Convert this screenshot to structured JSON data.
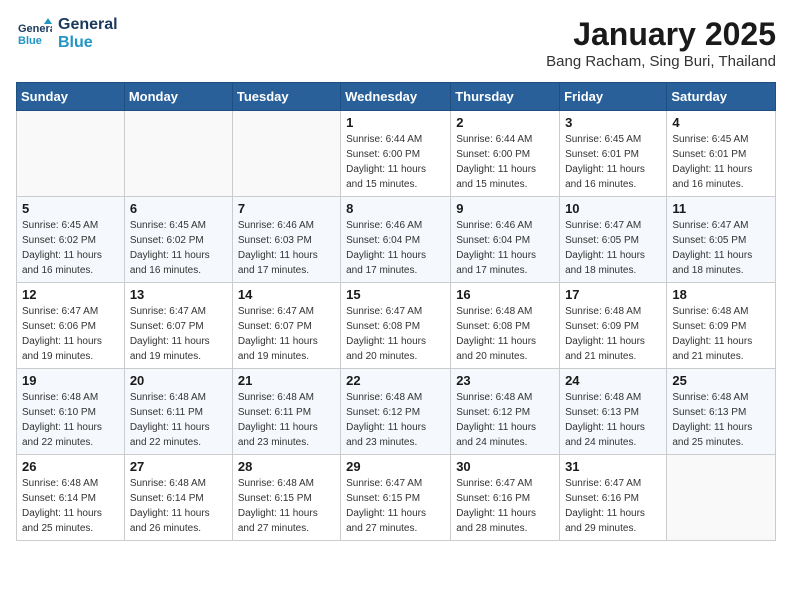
{
  "header": {
    "logo_line1": "General",
    "logo_line2": "Blue",
    "title": "January 2025",
    "subtitle": "Bang Racham, Sing Buri, Thailand"
  },
  "weekdays": [
    "Sunday",
    "Monday",
    "Tuesday",
    "Wednesday",
    "Thursday",
    "Friday",
    "Saturday"
  ],
  "weeks": [
    [
      {
        "day": "",
        "info": ""
      },
      {
        "day": "",
        "info": ""
      },
      {
        "day": "",
        "info": ""
      },
      {
        "day": "1",
        "info": "Sunrise: 6:44 AM\nSunset: 6:00 PM\nDaylight: 11 hours and 15 minutes."
      },
      {
        "day": "2",
        "info": "Sunrise: 6:44 AM\nSunset: 6:00 PM\nDaylight: 11 hours and 15 minutes."
      },
      {
        "day": "3",
        "info": "Sunrise: 6:45 AM\nSunset: 6:01 PM\nDaylight: 11 hours and 16 minutes."
      },
      {
        "day": "4",
        "info": "Sunrise: 6:45 AM\nSunset: 6:01 PM\nDaylight: 11 hours and 16 minutes."
      }
    ],
    [
      {
        "day": "5",
        "info": "Sunrise: 6:45 AM\nSunset: 6:02 PM\nDaylight: 11 hours and 16 minutes."
      },
      {
        "day": "6",
        "info": "Sunrise: 6:45 AM\nSunset: 6:02 PM\nDaylight: 11 hours and 16 minutes."
      },
      {
        "day": "7",
        "info": "Sunrise: 6:46 AM\nSunset: 6:03 PM\nDaylight: 11 hours and 17 minutes."
      },
      {
        "day": "8",
        "info": "Sunrise: 6:46 AM\nSunset: 6:04 PM\nDaylight: 11 hours and 17 minutes."
      },
      {
        "day": "9",
        "info": "Sunrise: 6:46 AM\nSunset: 6:04 PM\nDaylight: 11 hours and 17 minutes."
      },
      {
        "day": "10",
        "info": "Sunrise: 6:47 AM\nSunset: 6:05 PM\nDaylight: 11 hours and 18 minutes."
      },
      {
        "day": "11",
        "info": "Sunrise: 6:47 AM\nSunset: 6:05 PM\nDaylight: 11 hours and 18 minutes."
      }
    ],
    [
      {
        "day": "12",
        "info": "Sunrise: 6:47 AM\nSunset: 6:06 PM\nDaylight: 11 hours and 19 minutes."
      },
      {
        "day": "13",
        "info": "Sunrise: 6:47 AM\nSunset: 6:07 PM\nDaylight: 11 hours and 19 minutes."
      },
      {
        "day": "14",
        "info": "Sunrise: 6:47 AM\nSunset: 6:07 PM\nDaylight: 11 hours and 19 minutes."
      },
      {
        "day": "15",
        "info": "Sunrise: 6:47 AM\nSunset: 6:08 PM\nDaylight: 11 hours and 20 minutes."
      },
      {
        "day": "16",
        "info": "Sunrise: 6:48 AM\nSunset: 6:08 PM\nDaylight: 11 hours and 20 minutes."
      },
      {
        "day": "17",
        "info": "Sunrise: 6:48 AM\nSunset: 6:09 PM\nDaylight: 11 hours and 21 minutes."
      },
      {
        "day": "18",
        "info": "Sunrise: 6:48 AM\nSunset: 6:09 PM\nDaylight: 11 hours and 21 minutes."
      }
    ],
    [
      {
        "day": "19",
        "info": "Sunrise: 6:48 AM\nSunset: 6:10 PM\nDaylight: 11 hours and 22 minutes."
      },
      {
        "day": "20",
        "info": "Sunrise: 6:48 AM\nSunset: 6:11 PM\nDaylight: 11 hours and 22 minutes."
      },
      {
        "day": "21",
        "info": "Sunrise: 6:48 AM\nSunset: 6:11 PM\nDaylight: 11 hours and 23 minutes."
      },
      {
        "day": "22",
        "info": "Sunrise: 6:48 AM\nSunset: 6:12 PM\nDaylight: 11 hours and 23 minutes."
      },
      {
        "day": "23",
        "info": "Sunrise: 6:48 AM\nSunset: 6:12 PM\nDaylight: 11 hours and 24 minutes."
      },
      {
        "day": "24",
        "info": "Sunrise: 6:48 AM\nSunset: 6:13 PM\nDaylight: 11 hours and 24 minutes."
      },
      {
        "day": "25",
        "info": "Sunrise: 6:48 AM\nSunset: 6:13 PM\nDaylight: 11 hours and 25 minutes."
      }
    ],
    [
      {
        "day": "26",
        "info": "Sunrise: 6:48 AM\nSunset: 6:14 PM\nDaylight: 11 hours and 25 minutes."
      },
      {
        "day": "27",
        "info": "Sunrise: 6:48 AM\nSunset: 6:14 PM\nDaylight: 11 hours and 26 minutes."
      },
      {
        "day": "28",
        "info": "Sunrise: 6:48 AM\nSunset: 6:15 PM\nDaylight: 11 hours and 27 minutes."
      },
      {
        "day": "29",
        "info": "Sunrise: 6:47 AM\nSunset: 6:15 PM\nDaylight: 11 hours and 27 minutes."
      },
      {
        "day": "30",
        "info": "Sunrise: 6:47 AM\nSunset: 6:16 PM\nDaylight: 11 hours and 28 minutes."
      },
      {
        "day": "31",
        "info": "Sunrise: 6:47 AM\nSunset: 6:16 PM\nDaylight: 11 hours and 29 minutes."
      },
      {
        "day": "",
        "info": ""
      }
    ]
  ]
}
